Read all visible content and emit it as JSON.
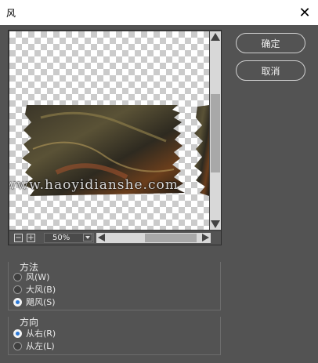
{
  "window": {
    "title": "风",
    "close_icon": "close-icon"
  },
  "preview": {
    "watermark": "www.haoyidianshe.com",
    "zoom": "50%"
  },
  "buttons": {
    "ok": "确定",
    "cancel": "取消"
  },
  "method": {
    "label": "方法",
    "options": [
      {
        "label": "风(W)",
        "selected": false
      },
      {
        "label": "大风(B)",
        "selected": false
      },
      {
        "label": "飓风(S)",
        "selected": true
      }
    ]
  },
  "direction": {
    "label": "方向",
    "options": [
      {
        "label": "从右(R)",
        "selected": true
      },
      {
        "label": "从左(L)",
        "selected": false
      }
    ]
  },
  "colors": {
    "accent": "#2b78d6",
    "panel": "#535353"
  }
}
